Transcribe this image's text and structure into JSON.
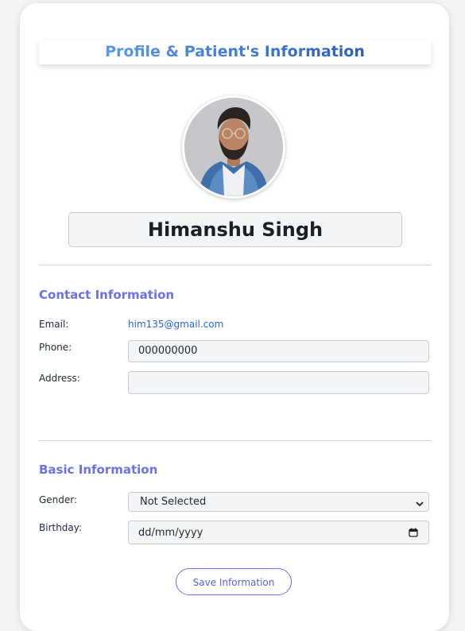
{
  "header": {
    "title": "Profile & Patient's Information"
  },
  "profile": {
    "name": "Himanshu Singh"
  },
  "contact": {
    "section_title": "Contact Information",
    "email_label": "Email:",
    "email_value": "him135@gmail.com",
    "phone_label": "Phone:",
    "phone_value": "000000000",
    "address_label": "Address:",
    "address_value": ""
  },
  "basic": {
    "section_title": "Basic Information",
    "gender_label": "Gender:",
    "gender_value": "Not Selected",
    "birthday_label": "Birthday:",
    "birthday_placeholder": "dd/mm/yyyy"
  },
  "actions": {
    "save_label": "Save Information"
  },
  "colors": {
    "accent": "#6a71ea",
    "title_gradient_start": "#5b98ea",
    "title_gradient_end": "#2a5fc5",
    "link": "#2563eb"
  }
}
